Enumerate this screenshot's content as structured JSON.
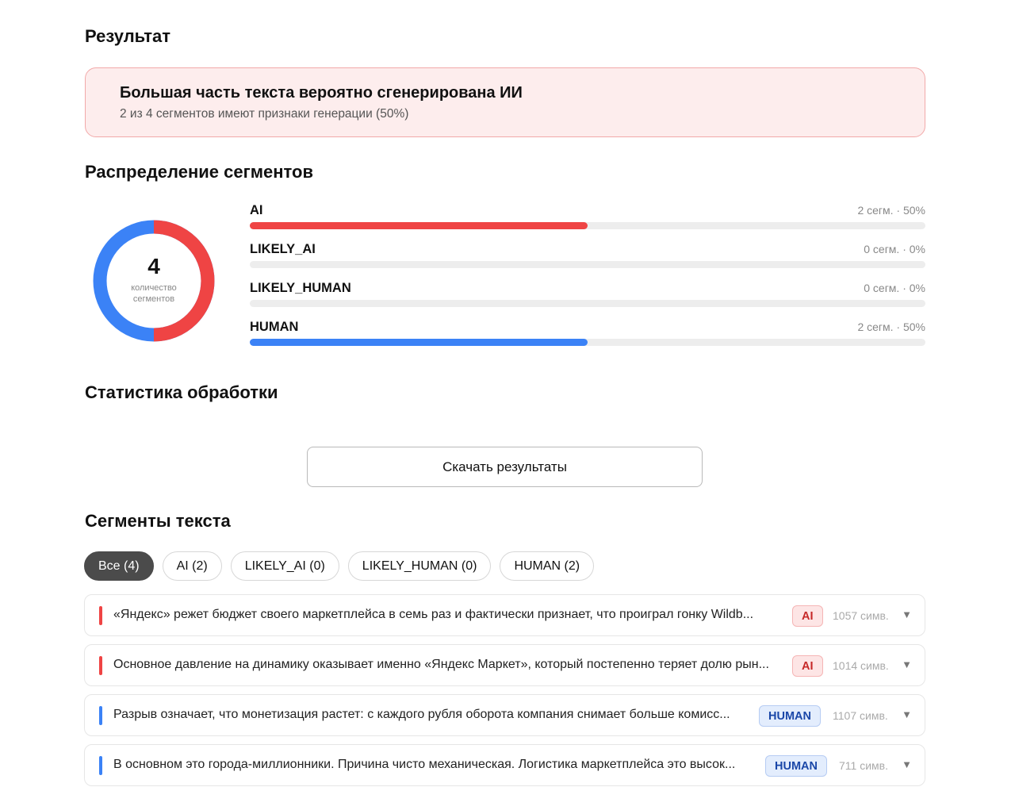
{
  "result": {
    "heading": "Результат",
    "alert_title": "Большая часть текста вероятно сгенерирована ИИ",
    "alert_subtitle": "2 из 4 сегментов имеют признаки генерации (50%)"
  },
  "distribution": {
    "heading": "Распределение сегментов",
    "total": "4",
    "total_caption_line1": "количество",
    "total_caption_line2": "сегментов",
    "colors": {
      "ai": "#ef4444",
      "human": "#3b82f6",
      "track": "#ededed"
    },
    "rows": [
      {
        "label": "AI",
        "count_text": "2 сегм. · 50%",
        "fraction": 0.5,
        "color": "#ef4444"
      },
      {
        "label": "LIKELY_AI",
        "count_text": "0 сегм. · 0%",
        "fraction": 0,
        "color": "#f59e0b"
      },
      {
        "label": "LIKELY_HUMAN",
        "count_text": "0 сегм. · 0%",
        "fraction": 0,
        "color": "#60a5fa"
      },
      {
        "label": "HUMAN",
        "count_text": "2 сегм. · 50%",
        "fraction": 0.5,
        "color": "#3b82f6"
      }
    ],
    "donut_fractions": {
      "ai": 0.5,
      "human": 0.5
    }
  },
  "stats": {
    "heading": "Статистика обработки"
  },
  "download_button": "Скачать результаты",
  "segments": {
    "heading": "Сегменты текста",
    "filters": [
      {
        "label": "Все (4)",
        "active": true
      },
      {
        "label": "AI (2)",
        "active": false
      },
      {
        "label": "LIKELY_AI (0)",
        "active": false
      },
      {
        "label": "LIKELY_HUMAN (0)",
        "active": false
      },
      {
        "label": "HUMAN (2)",
        "active": false
      }
    ],
    "items": [
      {
        "text": "«Яндекс» режет бюджет своего маркетплейса в семь раз и фактически признает, что проиграл гонку Wildb...",
        "badge": "AI",
        "chars": "1057 симв."
      },
      {
        "text": "Основное давление на динамику оказывает именно «Яндекс Маркет», который постепенно теряет долю рын...",
        "badge": "AI",
        "chars": "1014 симв."
      },
      {
        "text": "Разрыв означает, что монетизация растет: с каждого рубля оборота компания снимает больше комисс...",
        "badge": "HUMAN",
        "chars": "1107 симв."
      },
      {
        "text": "В основном это города-миллионники. Причина чисто механическая. Логистика маркетплейса это высок...",
        "badge": "HUMAN",
        "chars": "711 симв."
      }
    ],
    "expand_icon": "▼"
  }
}
